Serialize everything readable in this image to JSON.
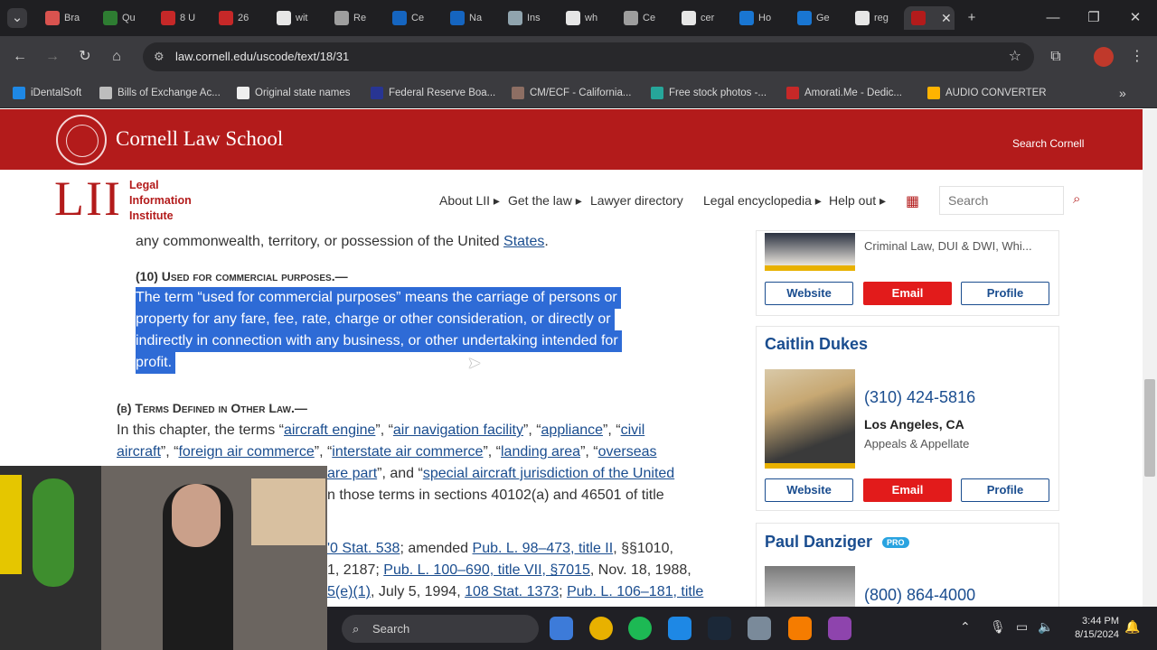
{
  "browser": {
    "tabs": [
      {
        "label": "Bra",
        "color": "#d9534f"
      },
      {
        "label": "Qu",
        "color": "#2e7d32"
      },
      {
        "label": "8 U",
        "color": "#c62828"
      },
      {
        "label": "26",
        "color": "#c62828"
      },
      {
        "label": "wit",
        "color": "#e6e6e6"
      },
      {
        "label": "Re",
        "color": "#9e9e9e"
      },
      {
        "label": "Ce",
        "color": "#1565c0"
      },
      {
        "label": "Na",
        "color": "#1565c0"
      },
      {
        "label": "Ins",
        "color": "#90a4ae"
      },
      {
        "label": "wh",
        "color": "#e6e6e6"
      },
      {
        "label": "Ce",
        "color": "#9e9e9e"
      },
      {
        "label": "cer",
        "color": "#e6e6e6"
      },
      {
        "label": "Ho",
        "color": "#1976d2"
      },
      {
        "label": "Ge",
        "color": "#1976d2"
      },
      {
        "label": "reg",
        "color": "#e6e6e6"
      }
    ],
    "url": "law.cornell.edu/uscode/text/18/31",
    "bookmarks": [
      {
        "label": "iDentalSoft",
        "color": "#1e88e5"
      },
      {
        "label": "Bills of Exchange Ac...",
        "color": "#bdbdbd"
      },
      {
        "label": "Original state names",
        "color": "#eeeeee"
      },
      {
        "label": "Federal Reserve Boa...",
        "color": "#283593"
      },
      {
        "label": "CM/ECF - California...",
        "color": "#8d6e63"
      },
      {
        "label": "Free stock photos -...",
        "color": "#26a69a"
      },
      {
        "label": "Amorati.Me - Dedic...",
        "color": "#c62828"
      },
      {
        "label": "AUDIO CONVERTER",
        "color": "#ffb300"
      }
    ]
  },
  "header": {
    "school": "Cornell Law School",
    "search_cornell": "Search Cornell",
    "lii_logo": "LII",
    "lii_name": "Legal Information Institute",
    "nav": [
      "About LII ▸",
      "Get the law ▸",
      "Lawyer directory",
      "Legal encyclopedia ▸",
      "Help out ▸"
    ],
    "search_placeholder": "Search"
  },
  "article": {
    "line0": "any commonwealth, territory, or possession of the United",
    "line0_link": "States",
    "p10_heading": "(10) Used for commercial purposes.—",
    "p10_lines": [
      "The term “used for commercial purposes” means the carriage of persons or",
      "property for any fare, fee, rate, charge or other consideration, or directly or",
      "indirectly in connection with any business, or other undertaking intended for",
      "profit."
    ],
    "b_heading": "(b) Terms Defined in Other Law.—",
    "b_line1_prefix": "In this chapter, the terms “",
    "b_terms": [
      "aircraft engine",
      "air navigation facility",
      "appliance",
      "civil aircraft",
      "foreign air commerce",
      "interstate air commerce",
      "landing area",
      "overseas",
      "are part",
      "special aircraft jurisdiction of the United"
    ],
    "b_line4": "n those terms in sections 40102(a) and 46501 of title",
    "hist_line1_link1": "'0 Stat. 538",
    "hist_line1_mid": "; amended ",
    "hist_line1_link2": "Pub. L. 98–473, title II",
    "hist_line1_end": ", §§1010,",
    "hist_line2_pre": "1, 2187; ",
    "hist_line2_link": "Pub. L. 100–690, title VII, §7015",
    "hist_line2_end": ", Nov. 18, 1988,",
    "hist_line3_link1": "5(e)(1)",
    "hist_line3_mid": ", July 5, 1994, ",
    "hist_line3_link2": "108 Stat. 1373",
    "hist_line3_sep": "; ",
    "hist_line3_link3": "Pub. L. 106–181, title"
  },
  "sidebar": {
    "card1_area": "Criminal Law, DUI & DWI, Whi...",
    "buttons": {
      "website": "Website",
      "email": "Email",
      "profile": "Profile"
    },
    "lawyer2": {
      "name": "Caitlin Dukes",
      "phone": "(310) 424-5816",
      "city": "Los Angeles, CA",
      "area": "Appeals & Appellate"
    },
    "lawyer3": {
      "name": "Paul Danziger",
      "badge": "PRO",
      "phone": "(800) 864-4000"
    }
  },
  "taskbar": {
    "search": "Search",
    "time": "3:44 PM",
    "date": "8/15/2024",
    "apps": [
      {
        "name": "maps",
        "color": "#3d7bd9"
      },
      {
        "name": "chrome",
        "color": "#e8b100"
      },
      {
        "name": "spotify",
        "color": "#1db954"
      },
      {
        "name": "r-app",
        "color": "#1e88e5"
      },
      {
        "name": "steam",
        "color": "#1b2838"
      },
      {
        "name": "settings",
        "color": "#7a8a9a"
      },
      {
        "name": "blender",
        "color": "#f57c00"
      },
      {
        "name": "app-purple",
        "color": "#8e44ad"
      }
    ]
  }
}
